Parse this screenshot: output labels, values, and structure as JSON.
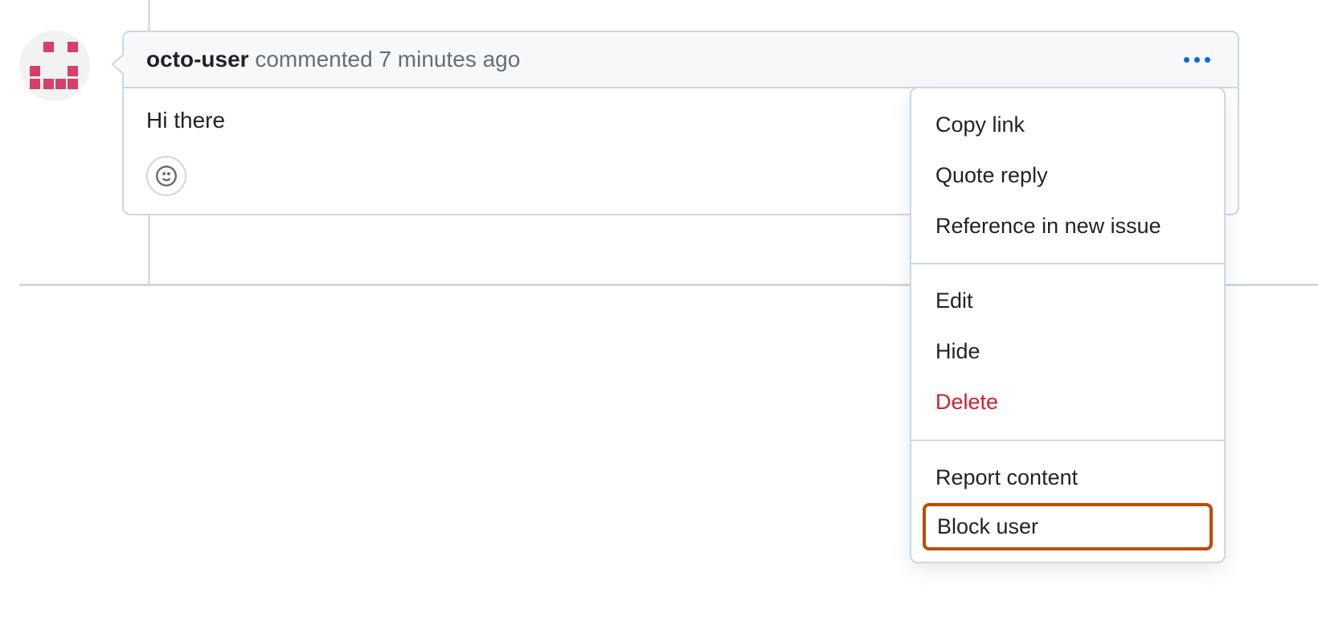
{
  "comment": {
    "author": "octo-user",
    "action_text": "commented",
    "timestamp": "7 minutes ago",
    "body": "Hi there"
  },
  "menu": {
    "group1": [
      {
        "label": "Copy link"
      },
      {
        "label": "Quote reply"
      },
      {
        "label": "Reference in new issue"
      }
    ],
    "group2": [
      {
        "label": "Edit"
      },
      {
        "label": "Hide"
      },
      {
        "label": "Delete",
        "danger": true
      }
    ],
    "group3": [
      {
        "label": "Report content"
      }
    ],
    "highlighted": {
      "label": "Block user"
    }
  }
}
